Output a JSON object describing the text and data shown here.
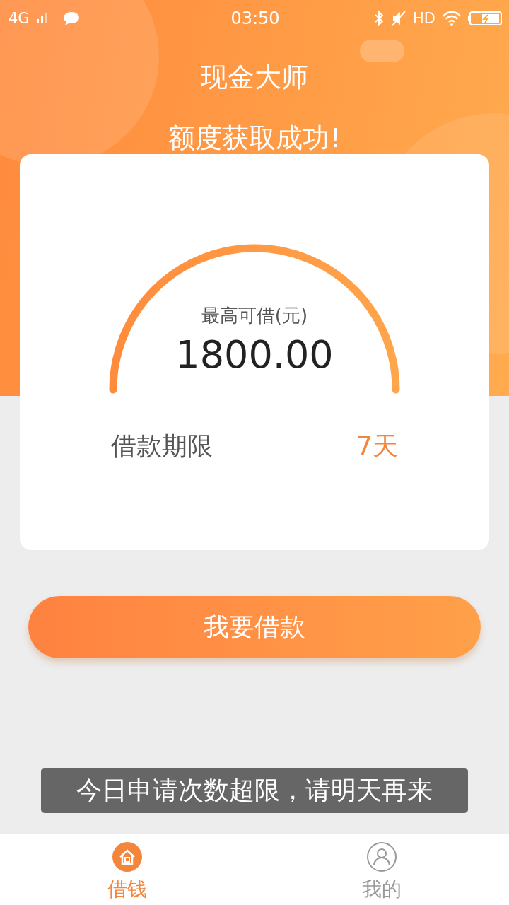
{
  "status_bar": {
    "network": "4G",
    "time": "03:50",
    "hd": "HD"
  },
  "app_title": "现金大师",
  "headline": "额度获取成功!",
  "quota_card": {
    "label": "最高可借(元)",
    "amount": "1800.00",
    "term_label": "借款期限",
    "term_value": "7天",
    "level": 1
  },
  "primary_button": "我要借款",
  "toast": "今日申请次数超限，请明天再来",
  "tab_bar": [
    {
      "label": "借钱",
      "kind": "home",
      "selected": true
    },
    {
      "label": "我的",
      "kind": "profile",
      "selected": false
    }
  ]
}
